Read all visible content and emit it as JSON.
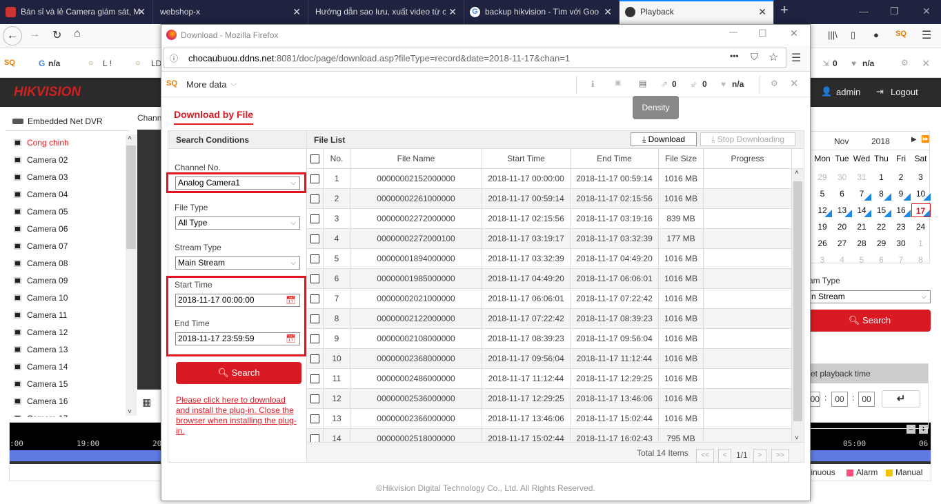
{
  "browser": {
    "tabs": [
      {
        "title": "Bán sỉ và lẻ Camera giám sát, M"
      },
      {
        "title": "webshop-x"
      },
      {
        "title": "Hướng dẫn sao lưu, xuất video từ c"
      },
      {
        "title": "backup hikvision - Tìm với Goo"
      },
      {
        "title": "Playback",
        "active": true
      }
    ],
    "bookmarks": [
      "n/a",
      "L  !",
      "LD"
    ],
    "toolbar_right": {
      "count1": "0",
      "status": "n/a"
    }
  },
  "app": {
    "logo": "HIKVISION",
    "user": "admin",
    "logout": "Logout",
    "device": "Embedded Net DVR",
    "channel_label": "Chann",
    "cameras": [
      "Cong chinh",
      "Camera 02",
      "Camera 03",
      "Camera 04",
      "Camera 05",
      "Camera 06",
      "Camera 07",
      "Camera 08",
      "Camera 09",
      "Camera 10",
      "Camera 11",
      "Camera 12",
      "Camera 13",
      "Camera 14",
      "Camera 15",
      "Camera 16",
      "Camera 17"
    ],
    "selected_camera": "Cong chinh",
    "calendar": {
      "month": "Nov",
      "year": "2018",
      "weekdays": [
        "Mon",
        "Tue",
        "Wed",
        "Thu",
        "Fri",
        "Sat"
      ],
      "weeks": [
        [
          "29",
          "30",
          "31",
          "1",
          "2",
          "3"
        ],
        [
          "5",
          "6",
          "7",
          "8",
          "9",
          "10"
        ],
        [
          "12",
          "13",
          "14",
          "15",
          "16",
          "17"
        ],
        [
          "19",
          "20",
          "21",
          "22",
          "23",
          "24"
        ],
        [
          "26",
          "27",
          "28",
          "29",
          "30",
          "1"
        ],
        [
          "3",
          "4",
          "5",
          "6",
          "7",
          "8"
        ]
      ],
      "selected": "17",
      "record_days": [
        "7",
        "8",
        "9",
        "10",
        "11",
        "12",
        "13",
        "14",
        "15",
        "16",
        "17"
      ]
    },
    "stream_type_label": "am Type",
    "stream_type_value": "n Stream",
    "search": "Search",
    "playback_time": {
      "title": "et playback time",
      "h": "00",
      "m": "00",
      "s": "00"
    },
    "timeline": {
      "ticks": [
        ":00",
        "19:00",
        "20",
        "05:00",
        "06"
      ]
    },
    "legend": [
      "tinuous",
      "Alarm",
      "Manual"
    ],
    "legend_colors": [
      "#ff4f7b",
      "#f5c400"
    ]
  },
  "popup": {
    "window_title": "Download - Mozilla Firefox",
    "url_host": "chocaubuou.ddns.net",
    "url_rest": ":8081/doc/page/download.asp?fileType=record&date=2018-11-17&chan=1",
    "more_data": "More data",
    "tooltip": "Density",
    "count_up": "0",
    "count_down": "0",
    "status": "n/a",
    "tab": "Download by File",
    "search_conditions": {
      "title": "Search Conditions",
      "channel_label": "Channel No.",
      "channel": "Analog Camera1",
      "file_type_label": "File Type",
      "file_type": "All Type",
      "stream_label": "Stream Type",
      "stream": "Main Stream",
      "start_label": "Start Time",
      "start": "2018-11-17 00:00:00",
      "end_label": "End Time",
      "end": "2018-11-17 23:59:59",
      "search": "Search",
      "plugin_link": "Please click here to download and install the plug-in. Close the browser when installing the plug-in."
    },
    "file_list": {
      "title": "File List",
      "download": "Download",
      "stop": "Stop Downloading",
      "columns": [
        "No.",
        "File Name",
        "Start Time",
        "End Time",
        "File Size",
        "Progress"
      ],
      "rows": [
        [
          "1",
          "00000002152000000",
          "2018-11-17 00:00:00",
          "2018-11-17 00:59:14",
          "1016 MB"
        ],
        [
          "2",
          "00000002261000000",
          "2018-11-17 00:59:14",
          "2018-11-17 02:15:56",
          "1016 MB"
        ],
        [
          "3",
          "00000002272000000",
          "2018-11-17 02:15:56",
          "2018-11-17 03:19:16",
          "839 MB"
        ],
        [
          "4",
          "00000002272000100",
          "2018-11-17 03:19:17",
          "2018-11-17 03:32:39",
          "177 MB"
        ],
        [
          "5",
          "00000001894000000",
          "2018-11-17 03:32:39",
          "2018-11-17 04:49:20",
          "1016 MB"
        ],
        [
          "6",
          "00000001985000000",
          "2018-11-17 04:49:20",
          "2018-11-17 06:06:01",
          "1016 MB"
        ],
        [
          "7",
          "00000002021000000",
          "2018-11-17 06:06:01",
          "2018-11-17 07:22:42",
          "1016 MB"
        ],
        [
          "8",
          "00000002122000000",
          "2018-11-17 07:22:42",
          "2018-11-17 08:39:23",
          "1016 MB"
        ],
        [
          "9",
          "00000002108000000",
          "2018-11-17 08:39:23",
          "2018-11-17 09:56:04",
          "1016 MB"
        ],
        [
          "10",
          "00000002368000000",
          "2018-11-17 09:56:04",
          "2018-11-17 11:12:44",
          "1016 MB"
        ],
        [
          "11",
          "00000002486000000",
          "2018-11-17 11:12:44",
          "2018-11-17 12:29:25",
          "1016 MB"
        ],
        [
          "12",
          "00000002536000000",
          "2018-11-17 12:29:25",
          "2018-11-17 13:46:06",
          "1016 MB"
        ],
        [
          "13",
          "00000002366000000",
          "2018-11-17 13:46:06",
          "2018-11-17 15:02:44",
          "1016 MB"
        ],
        [
          "14",
          "00000002518000000",
          "2018-11-17 15:02:44",
          "2018-11-17 16:02:43",
          "795 MB"
        ]
      ],
      "total": "Total 14 Items",
      "page": "1/1",
      "first": "<<",
      "prev": "<",
      "next": ">",
      "last": ">>"
    },
    "copyright": "©Hikvision Digital Technology Co., Ltd. All Rights Reserved."
  },
  "colors": {
    "accent": "#da1a23",
    "tabbar": "#1f2340",
    "header": "#2b2b2b",
    "timeline_bar": "#5f7be3"
  }
}
